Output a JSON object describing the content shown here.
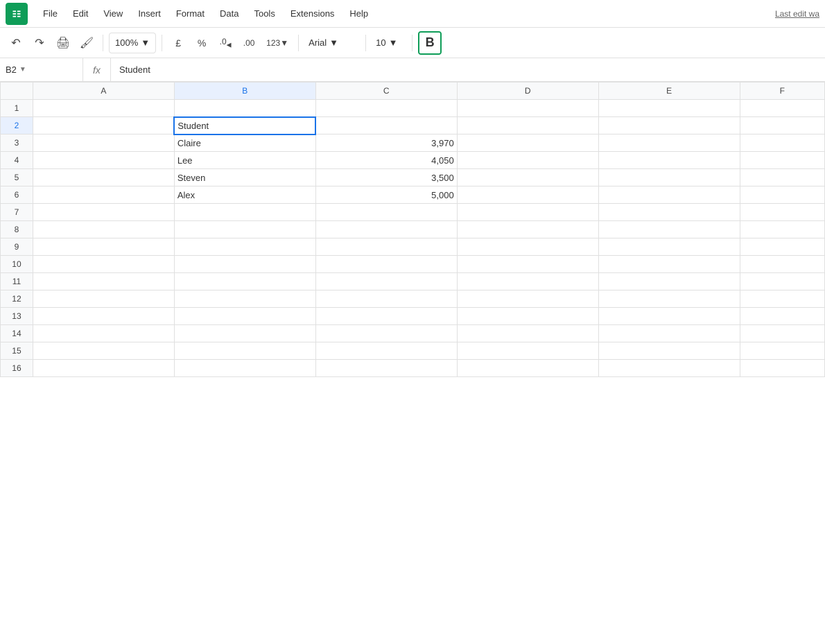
{
  "app": {
    "icon_color": "#0f9d58"
  },
  "menu": {
    "items": [
      "File",
      "Edit",
      "View",
      "Insert",
      "Format",
      "Data",
      "Tools",
      "Extensions",
      "Help"
    ],
    "last_edit": "Last edit wa"
  },
  "toolbar": {
    "zoom": "100%",
    "currency": "£",
    "percent": "%",
    "decimal_less": ".0",
    "decimal_more": ".00",
    "format_123": "123",
    "font": "Arial",
    "font_size": "10",
    "bold": "B"
  },
  "formula_bar": {
    "cell_ref": "B2",
    "fx_label": "fx",
    "formula": "Student"
  },
  "grid": {
    "columns": [
      "",
      "A",
      "B",
      "C",
      "D",
      "E",
      "F"
    ],
    "rows": [
      {
        "num": 1,
        "a": "",
        "b": "",
        "c": "",
        "d": "",
        "e": "",
        "f": ""
      },
      {
        "num": 2,
        "a": "",
        "b": "Student",
        "c": "",
        "d": "",
        "e": "",
        "f": "",
        "active": true
      },
      {
        "num": 3,
        "a": "",
        "b": "Claire",
        "c": "3,970",
        "d": "",
        "e": "",
        "f": ""
      },
      {
        "num": 4,
        "a": "",
        "b": "Lee",
        "c": "4,050",
        "d": "",
        "e": "",
        "f": ""
      },
      {
        "num": 5,
        "a": "",
        "b": "Steven",
        "c": "3,500",
        "d": "",
        "e": "",
        "f": ""
      },
      {
        "num": 6,
        "a": "",
        "b": "Alex",
        "c": "5,000",
        "d": "",
        "e": "",
        "f": ""
      },
      {
        "num": 7,
        "a": "",
        "b": "",
        "c": "",
        "d": "",
        "e": "",
        "f": ""
      },
      {
        "num": 8,
        "a": "",
        "b": "",
        "c": "",
        "d": "",
        "e": "",
        "f": ""
      },
      {
        "num": 9,
        "a": "",
        "b": "",
        "c": "",
        "d": "",
        "e": "",
        "f": ""
      },
      {
        "num": 10,
        "a": "",
        "b": "",
        "c": "",
        "d": "",
        "e": "",
        "f": ""
      },
      {
        "num": 11,
        "a": "",
        "b": "",
        "c": "",
        "d": "",
        "e": "",
        "f": ""
      },
      {
        "num": 12,
        "a": "",
        "b": "",
        "c": "",
        "d": "",
        "e": "",
        "f": ""
      },
      {
        "num": 13,
        "a": "",
        "b": "",
        "c": "",
        "d": "",
        "e": "",
        "f": ""
      },
      {
        "num": 14,
        "a": "",
        "b": "",
        "c": "",
        "d": "",
        "e": "",
        "f": ""
      },
      {
        "num": 15,
        "a": "",
        "b": "",
        "c": "",
        "d": "",
        "e": "",
        "f": ""
      },
      {
        "num": 16,
        "a": "",
        "b": "",
        "c": "",
        "d": "",
        "e": "",
        "f": ""
      }
    ]
  }
}
